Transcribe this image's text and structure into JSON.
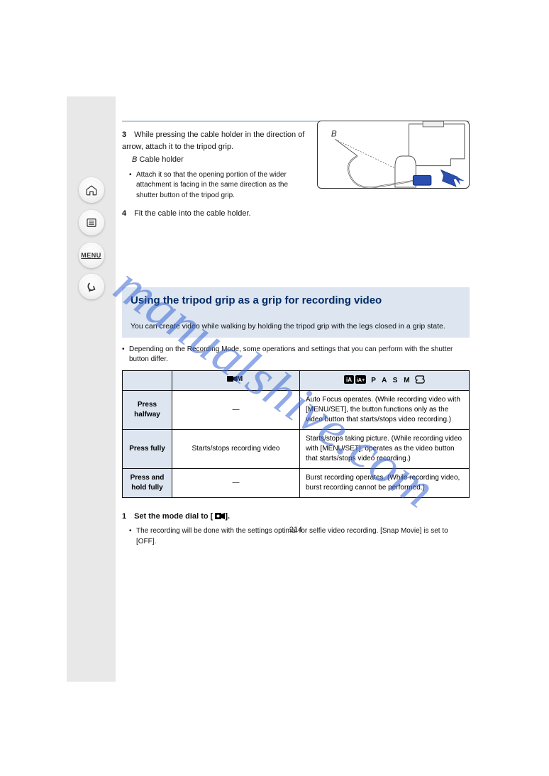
{
  "watermark": "manualshive.com",
  "page_number": "214",
  "sidebar": {
    "home_icon": "home-icon",
    "list_icon": "list-icon",
    "menu_label": "MENU",
    "back_icon": "back-icon"
  },
  "step3": {
    "num": "3",
    "text_a": "While pressing the cable holder in the direction of arrow, attach it to the tripod grip.",
    "callout_B": "B",
    "text_b_label": "Cable holder",
    "bullet": "Attach it so that the opening portion of the wider attachment is facing in the same direction as the shutter button of the tripod grip."
  },
  "step4": {
    "num": "4",
    "text": "Fit the cable into the cable holder."
  },
  "section": {
    "title": "Using the tripod grip as a grip for recording video",
    "line": "You can create video while walking by holding the tripod grip with the legs closed in a grip state."
  },
  "table_note": "Depending on the Recording Mode, some operations and settings that you can perform with the shutter button differ.",
  "table": {
    "header_left": "",
    "header_mid_icon": "video-m-icon",
    "header_mid_text": "M",
    "header_right_icons": "iA-icon iA+-icon",
    "header_right_text": "P A S M",
    "header_right_trail_icon": "custom-icon",
    "rows": [
      {
        "left": "Press halfway",
        "mid": "—",
        "right": "Auto Focus operates. (While recording video with [MENU/SET], the button functions only as the video button that starts/stops video recording.)"
      },
      {
        "left": "Press fully",
        "mid": "Starts/stops recording video",
        "right": "Starts/stops taking picture. (While recording video with [MENU/SET], operates as the video button that starts/stops video recording.)"
      },
      {
        "left": "Press and hold fully",
        "mid": "—",
        "right": "Burst recording operates. (While recording video, burst recording cannot be performed.)"
      }
    ]
  },
  "dial_step": {
    "num": "1",
    "text_a": "Set the mode dial to [",
    "text_b": "].",
    "bullet": "The recording will be done with the settings optimal for selfie video recording. [Snap Movie] is set to [OFF]."
  }
}
